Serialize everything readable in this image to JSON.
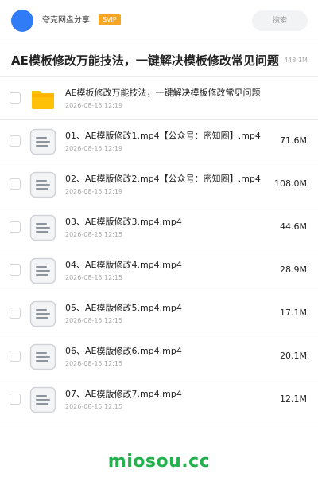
{
  "header": {
    "username": "夸克网盘分享",
    "badge": "SVIP",
    "search_placeholder": "搜索",
    "colors": {
      "avatar": "#2f7cf6",
      "badge": "#f6a623"
    }
  },
  "title": {
    "text": "AE模板修改万能技法，一键解决模板修改常见问题",
    "size": "· 448.1M"
  },
  "files": [
    {
      "type": "folder",
      "icon": "folder-icon",
      "name": "AE模板修改万能技法，一键解决模板修改常见问题",
      "date": "2026-08-15 12:19",
      "size": ""
    },
    {
      "type": "file",
      "icon": "document-icon",
      "name": "01、AE模版修改1.mp4【公众号：密知圈】.mp4",
      "date": "2026-08-15 12:19",
      "size": "71.6M"
    },
    {
      "type": "file",
      "icon": "document-icon",
      "name": "02、AE模版修改2.mp4【公众号：密知圈】.mp4",
      "date": "2026-08-15 12:19",
      "size": "108.0M"
    },
    {
      "type": "file",
      "icon": "document-icon",
      "name": "03、AE模版修改3.mp4.mp4",
      "date": "2026-08-15 12:15",
      "size": "44.6M"
    },
    {
      "type": "file",
      "icon": "document-icon",
      "name": "04、AE模版修改4.mp4.mp4",
      "date": "2026-08-15 12:15",
      "size": "28.9M"
    },
    {
      "type": "file",
      "icon": "document-icon",
      "name": "05、AE模版修改5.mp4.mp4",
      "date": "2026-08-15 12:15",
      "size": "17.1M"
    },
    {
      "type": "file",
      "icon": "document-icon",
      "name": "06、AE模版修改6.mp4.mp4",
      "date": "2026-08-15 12:15",
      "size": "20.1M"
    },
    {
      "type": "file",
      "icon": "document-icon",
      "name": "07、AE模版修改7.mp4.mp4",
      "date": "2026-08-15 12:15",
      "size": "12.1M"
    }
  ],
  "footer": {
    "brand": "miosou.cc",
    "color": "#22b14c"
  }
}
